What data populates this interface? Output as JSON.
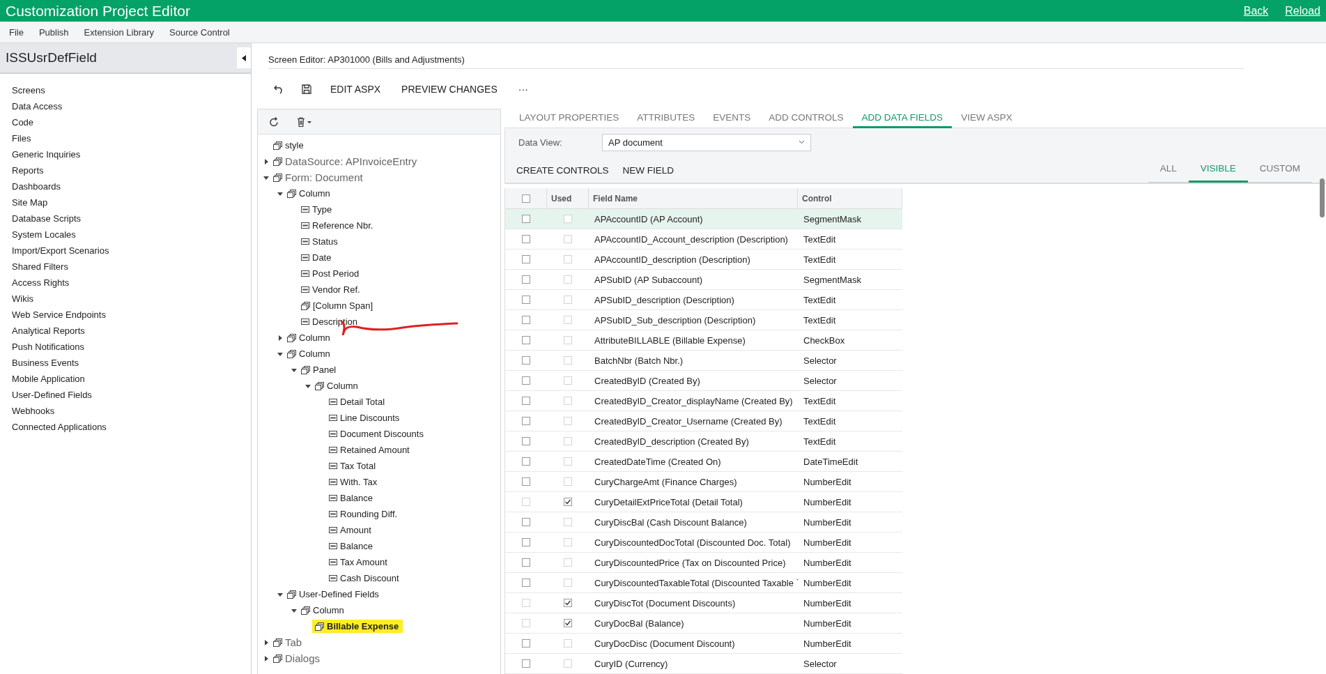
{
  "window": {
    "title": "Customization Project Editor",
    "links": [
      "Back",
      "Reload"
    ]
  },
  "menu": [
    "File",
    "Publish",
    "Extension Library",
    "Source Control"
  ],
  "sidebar": {
    "title": "ISSUsrDefField",
    "items": [
      "Screens",
      "Data Access",
      "Code",
      "Files",
      "Generic Inquiries",
      "Reports",
      "Dashboards",
      "Site Map",
      "Database Scripts",
      "System Locales",
      "Import/Export Scenarios",
      "Shared Filters",
      "Access Rights",
      "Wikis",
      "Web Service Endpoints",
      "Analytical Reports",
      "Push Notifications",
      "Business Events",
      "Mobile Application",
      "User-Defined Fields",
      "Webhooks",
      "Connected Applications"
    ]
  },
  "editor": {
    "title": "Screen Editor: AP301000 (Bills and Adjustments)",
    "toolbar": [
      "EDIT ASPX",
      "PREVIEW CHANGES"
    ],
    "more": "···"
  },
  "tree": [
    {
      "label": "style",
      "kind": "container"
    },
    {
      "label": "DataSource: APInvoiceEntry",
      "kind": "section",
      "expanded": false
    },
    {
      "label": "Form: Document",
      "kind": "section",
      "expanded": true,
      "children": [
        {
          "label": "Column",
          "kind": "container",
          "expanded": true,
          "children": [
            {
              "label": "Type",
              "kind": "field"
            },
            {
              "label": "Reference Nbr.",
              "kind": "field"
            },
            {
              "label": "Status",
              "kind": "field"
            },
            {
              "label": "Date",
              "kind": "field"
            },
            {
              "label": "Post Period",
              "kind": "field"
            },
            {
              "label": "Vendor Ref.",
              "kind": "field"
            },
            {
              "label": "[Column Span]",
              "kind": "container"
            },
            {
              "label": "Description",
              "kind": "field"
            }
          ]
        },
        {
          "label": "Column",
          "kind": "container",
          "expanded": false
        },
        {
          "label": "Column",
          "kind": "container",
          "expanded": true,
          "children": [
            {
              "label": "Panel",
              "kind": "container",
              "expanded": true,
              "children": [
                {
                  "label": "Column",
                  "kind": "container",
                  "expanded": true,
                  "children": [
                    {
                      "label": "Detail Total",
                      "kind": "field"
                    },
                    {
                      "label": "Line Discounts",
                      "kind": "field"
                    },
                    {
                      "label": "Document Discounts",
                      "kind": "field"
                    },
                    {
                      "label": "Retained Amount",
                      "kind": "field"
                    },
                    {
                      "label": "Tax Total",
                      "kind": "field"
                    },
                    {
                      "label": "With. Tax",
                      "kind": "field"
                    },
                    {
                      "label": "Balance",
                      "kind": "field"
                    },
                    {
                      "label": "Rounding Diff.",
                      "kind": "field"
                    },
                    {
                      "label": "Amount",
                      "kind": "field"
                    },
                    {
                      "label": "Balance",
                      "kind": "field"
                    },
                    {
                      "label": "Tax Amount",
                      "kind": "field"
                    },
                    {
                      "label": "Cash Discount",
                      "kind": "field"
                    }
                  ]
                }
              ]
            }
          ]
        },
        {
          "label": "User-Defined Fields",
          "kind": "container",
          "expanded": true,
          "children": [
            {
              "label": "Column",
              "kind": "container",
              "expanded": true,
              "children": [
                {
                  "label": "Billable Expense",
                  "kind": "container",
                  "highlighted": true
                }
              ]
            }
          ]
        }
      ]
    },
    {
      "label": "Tab",
      "kind": "section",
      "expanded": false
    },
    {
      "label": "Dialogs",
      "kind": "section",
      "expanded": false
    }
  ],
  "tabs": [
    {
      "label": "LAYOUT PROPERTIES",
      "selected": false
    },
    {
      "label": "ATTRIBUTES",
      "selected": false
    },
    {
      "label": "EVENTS",
      "selected": false
    },
    {
      "label": "ADD CONTROLS",
      "selected": false
    },
    {
      "label": "ADD DATA FIELDS",
      "selected": true
    },
    {
      "label": "VIEW ASPX",
      "selected": false
    }
  ],
  "data_view": {
    "label": "Data View:",
    "value": "AP document"
  },
  "actions": [
    "CREATE CONTROLS",
    "NEW FIELD"
  ],
  "filters": [
    {
      "label": "ALL",
      "selected": false
    },
    {
      "label": "VISIBLE",
      "selected": true
    },
    {
      "label": "CUSTOM",
      "selected": false
    }
  ],
  "table": {
    "select_all": false,
    "columns": [
      "Used",
      "Field Name",
      "Control"
    ],
    "rows": [
      {
        "selected": true,
        "checked": false,
        "disabled": false,
        "used": false,
        "field": "APAccountID (AP Account)",
        "control": "SegmentMask"
      },
      {
        "selected": false,
        "checked": false,
        "disabled": false,
        "used": false,
        "field": "APAccountID_Account_description (Description)",
        "control": "TextEdit"
      },
      {
        "selected": false,
        "checked": false,
        "disabled": false,
        "used": false,
        "field": "APAccountID_description (Description)",
        "control": "TextEdit"
      },
      {
        "selected": false,
        "checked": false,
        "disabled": false,
        "used": false,
        "field": "APSubID (AP Subaccount)",
        "control": "SegmentMask"
      },
      {
        "selected": false,
        "checked": false,
        "disabled": false,
        "used": false,
        "field": "APSubID_description (Description)",
        "control": "TextEdit"
      },
      {
        "selected": false,
        "checked": false,
        "disabled": false,
        "used": false,
        "field": "APSubID_Sub_description (Description)",
        "control": "TextEdit"
      },
      {
        "selected": false,
        "checked": false,
        "disabled": false,
        "used": false,
        "field": "AttributeBILLABLE (Billable Expense)",
        "control": "CheckBox"
      },
      {
        "selected": false,
        "checked": false,
        "disabled": false,
        "used": false,
        "field": "BatchNbr (Batch Nbr.)",
        "control": "Selector"
      },
      {
        "selected": false,
        "checked": false,
        "disabled": false,
        "used": false,
        "field": "CreatedByID (Created By)",
        "control": "Selector"
      },
      {
        "selected": false,
        "checked": false,
        "disabled": false,
        "used": false,
        "field": "CreatedByID_Creator_displayName (Created By)",
        "control": "TextEdit"
      },
      {
        "selected": false,
        "checked": false,
        "disabled": false,
        "used": false,
        "field": "CreatedByID_Creator_Username (Created By)",
        "control": "TextEdit"
      },
      {
        "selected": false,
        "checked": false,
        "disabled": false,
        "used": false,
        "field": "CreatedByID_description (Created By)",
        "control": "TextEdit"
      },
      {
        "selected": false,
        "checked": false,
        "disabled": false,
        "used": false,
        "field": "CreatedDateTime (Created On)",
        "control": "DateTimeEdit"
      },
      {
        "selected": false,
        "checked": false,
        "disabled": false,
        "used": false,
        "field": "CuryChargeAmt (Finance Charges)",
        "control": "NumberEdit"
      },
      {
        "selected": false,
        "checked": false,
        "disabled": true,
        "used": true,
        "field": "CuryDetailExtPriceTotal (Detail Total)",
        "control": "NumberEdit"
      },
      {
        "selected": false,
        "checked": false,
        "disabled": false,
        "used": false,
        "field": "CuryDiscBal (Cash Discount Balance)",
        "control": "NumberEdit"
      },
      {
        "selected": false,
        "checked": false,
        "disabled": false,
        "used": false,
        "field": "CuryDiscountedDocTotal (Discounted Doc. Total)",
        "control": "NumberEdit"
      },
      {
        "selected": false,
        "checked": false,
        "disabled": false,
        "used": false,
        "field": "CuryDiscountedPrice (Tax on Discounted Price)",
        "control": "NumberEdit"
      },
      {
        "selected": false,
        "checked": false,
        "disabled": false,
        "used": false,
        "field": "CuryDiscountedTaxableTotal (Discounted Taxable `",
        "control": "NumberEdit"
      },
      {
        "selected": false,
        "checked": false,
        "disabled": true,
        "used": true,
        "field": "CuryDiscTot (Document Discounts)",
        "control": "NumberEdit"
      },
      {
        "selected": false,
        "checked": false,
        "disabled": true,
        "used": true,
        "field": "CuryDocBal (Balance)",
        "control": "NumberEdit"
      },
      {
        "selected": false,
        "checked": false,
        "disabled": false,
        "used": false,
        "field": "CuryDocDisc (Document Discount)",
        "control": "NumberEdit"
      },
      {
        "selected": false,
        "checked": false,
        "disabled": false,
        "used": false,
        "field": "CuryID (Currency)",
        "control": "Selector"
      }
    ]
  }
}
